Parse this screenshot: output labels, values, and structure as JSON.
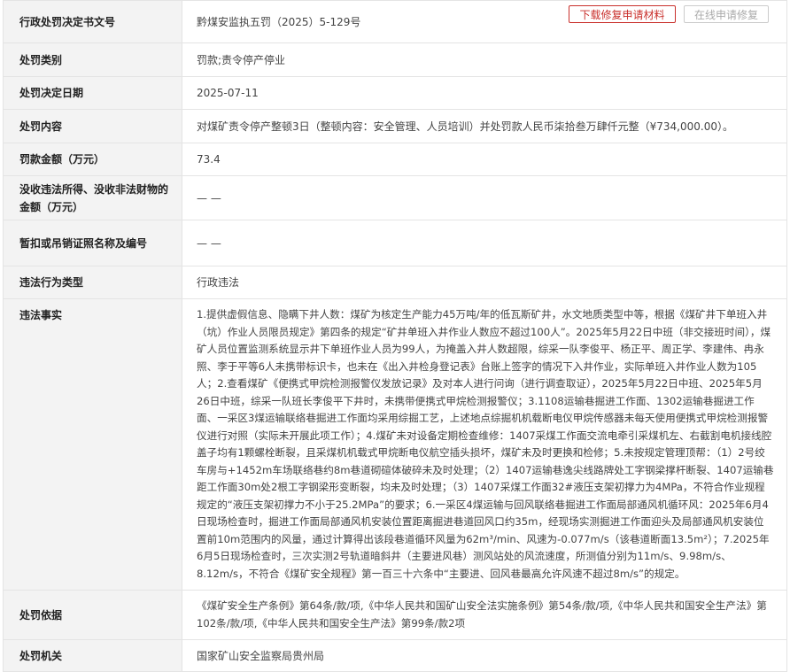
{
  "rows": [
    {
      "label": "行政处罚决定书文号",
      "value": "黔煤安监执五罚（2025）5-129号"
    },
    {
      "label": "处罚类别",
      "value": "罚款;责令停产停业"
    },
    {
      "label": "处罚决定日期",
      "value": "2025-07-11"
    },
    {
      "label": "处罚内容",
      "value": "对煤矿责令停产整顿3日（整顿内容：安全管理、人员培训）并处罚款人民币柒拾叁万肆仟元整（¥734,000.00）。"
    },
    {
      "label": "罚款金额（万元）",
      "value": "73.4"
    },
    {
      "label": "没收违法所得、没收非法财物的金额（万元）",
      "value": "— —"
    },
    {
      "label": "暂扣或吊销证照名称及编号",
      "value": "— —"
    },
    {
      "label": "违法行为类型",
      "value": "行政违法"
    },
    {
      "label": "违法事实",
      "value": "1.提供虚假信息、隐瞒下井人数：煤矿为核定生产能力45万吨/年的低瓦斯矿井，水文地质类型中等，根据《煤矿井下单班入井（坑）作业人员限员规定》第四条的规定“矿井单班入井作业人数应不超过100人”。2025年5月22日中班（非交接班时间），煤矿人员位置监测系统显示井下单班作业人员为99人，为掩盖入井人数超限，综采一队李俊平、杨正平、周正学、李建伟、冉永照、李于平等6人未携带标识卡，也未在《出入井检身登记表》台账上签字的情况下入井作业，实际单班入井作业人数为105人；2.查看煤矿《便携式甲烷检测报警仪发放记录》及对本人进行问询（进行调查取证），2025年5月22日中班、2025年5月26日中班，综采一队班长李俊平下井时，未携带便携式甲烷检测报警仪；3.1108运输巷掘进工作面、1302运输巷掘进工作面、一采区3煤运输联络巷掘进工作面均采用综掘工艺，上述地点综掘机机载断电仪甲烷传感器未每天使用便携式甲烷检测报警仪进行对照（实际未开展此项工作）；4.煤矿未对设备定期检查维修：1407采煤工作面交流电牵引采煤机左、右截割电机接线腔盖子均有1颗螺栓断裂，且采煤机机载式甲烷断电仪航空插头损坏，煤矿未及时更换和检修；5.未按规定管理顶帮：（1）2号绞车房与+1452m车场联络巷约8m巷道砌碹体破碎未及时处理；（2）1407运输巷逸尖线路牌处工字钢梁撑杆断裂、1407运输巷距工作面30m处2根工字钢梁形变断裂，均未及时处理；（3）1407采煤工作面32#液压支架初撑力为4MPa，不符合作业规程规定的“液压支架初撑力不小于25.2MPa”的要求；6.一采区4煤运输与回风联络巷掘进工作面局部通风机循环风：2025年6月4日现场检查时，掘进工作面局部通风机安装位置距离掘进巷道回风口约35m，经现场实测掘进工作面迎头及局部通风机安装位置前10m范围内的风量，通过计算得出该段巷道循环风量为62m³/min、风速为-0.077m/s（该巷道断面13.5m²）；7.2025年6月5日现场检查时，三次实测2号轨道暗斜井（主要进风巷）测风站处的风流速度，所测值分别为11m/s、9.98m/s、8.12m/s，不符合《煤矿安全规程》第一百三十六条中“主要进、回风巷最高允许风速不超过8m/s”的规定。"
    },
    {
      "label": "处罚依据",
      "value": "《煤矿安全生产条例》第64条/款/项,《中华人民共和国矿山安全法实施条例》第54条/款/项,《中华人民共和国安全生产法》第102条/款/项,《中华人民共和国安全生产法》第99条/款2项"
    },
    {
      "label": "处罚机关",
      "value": "国家矿山安全监察局贵州局"
    }
  ],
  "actions": {
    "download_label": "下载修复申请材料",
    "online_label": "在线申请修复"
  },
  "colors": {
    "label_bg": "#f3f3f3",
    "border": "#e4e4e4",
    "download_accent": "#c9302c",
    "disabled_text": "#aaaaaa"
  }
}
